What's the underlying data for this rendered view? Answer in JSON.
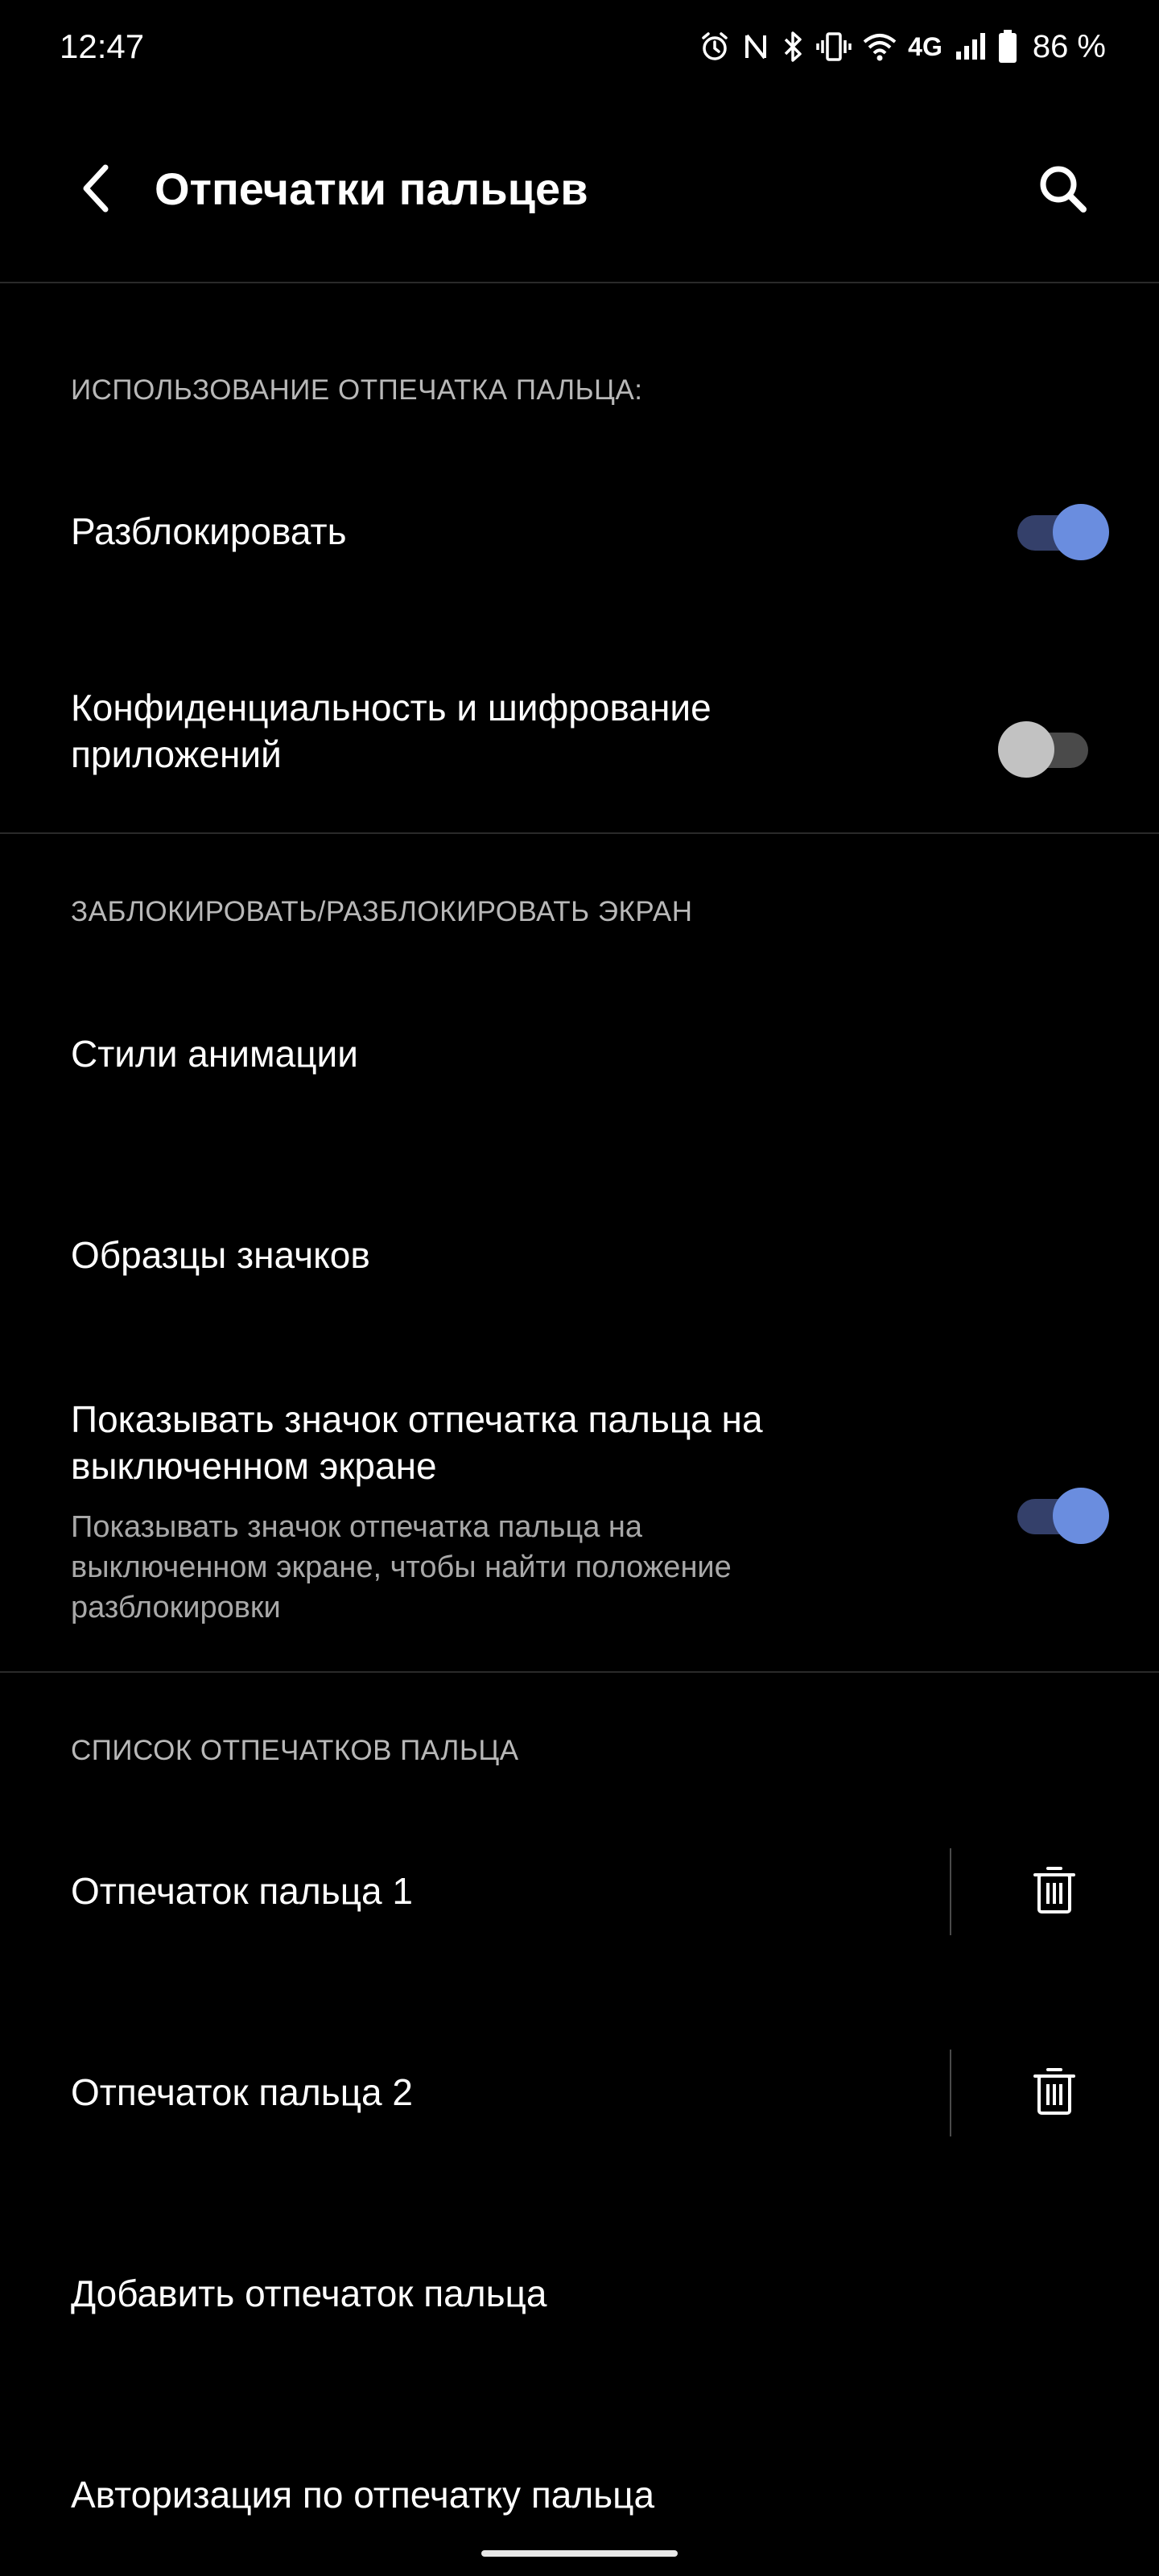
{
  "status_bar": {
    "time": "12:47",
    "network": "4G",
    "battery": "86 %",
    "icons": [
      "alarm-icon",
      "nfc-icon",
      "bluetooth-icon",
      "vibrate-icon",
      "wifi-icon",
      "signal-icon",
      "battery-icon"
    ]
  },
  "app_bar": {
    "title": "Отпечатки пальцев",
    "back_icon": "back-arrow-icon",
    "search_icon": "search-icon"
  },
  "sections": {
    "usage": {
      "header": "ИСПОЛЬЗОВАНИЕ ОТПЕЧАТКА ПАЛЬЦА:",
      "unlock": {
        "label": "Разблокировать",
        "enabled": true
      },
      "privacy": {
        "label_line1": "Конфиденциальность и шифрование",
        "label_line2": "приложений",
        "enabled": false
      }
    },
    "lock_screen": {
      "header": "ЗАБЛОКИРОВАТЬ/РАЗБЛОКИРОВАТЬ ЭКРАН",
      "animation_styles": "Стили анимации",
      "icon_samples": "Образцы значков",
      "show_icon": {
        "title_line1": "Показывать значок отпечатка пальца на",
        "title_line2": "выключенном экране",
        "subtitle_line1": "Показывать значок отпечатка пальца на",
        "subtitle_line2": "выключенном экране, чтобы найти положение",
        "subtitle_line3": "разблокировки",
        "enabled": true
      }
    },
    "fingerprints": {
      "header": "СПИСОК ОТПЕЧАТКОВ ПАЛЬЦА",
      "items": [
        {
          "label": "Отпечаток пальца 1"
        },
        {
          "label": "Отпечаток пальца 2"
        }
      ],
      "add": "Добавить отпечаток пальца",
      "auth": "Авторизация по отпечатку пальца"
    }
  },
  "colors": {
    "background": "#000000",
    "accent": "#6a8ddf",
    "accent_track": "#34406a",
    "section_header": "#b8b8b8",
    "subtitle": "#a8a8a8",
    "divider": "#2a2a2a"
  }
}
